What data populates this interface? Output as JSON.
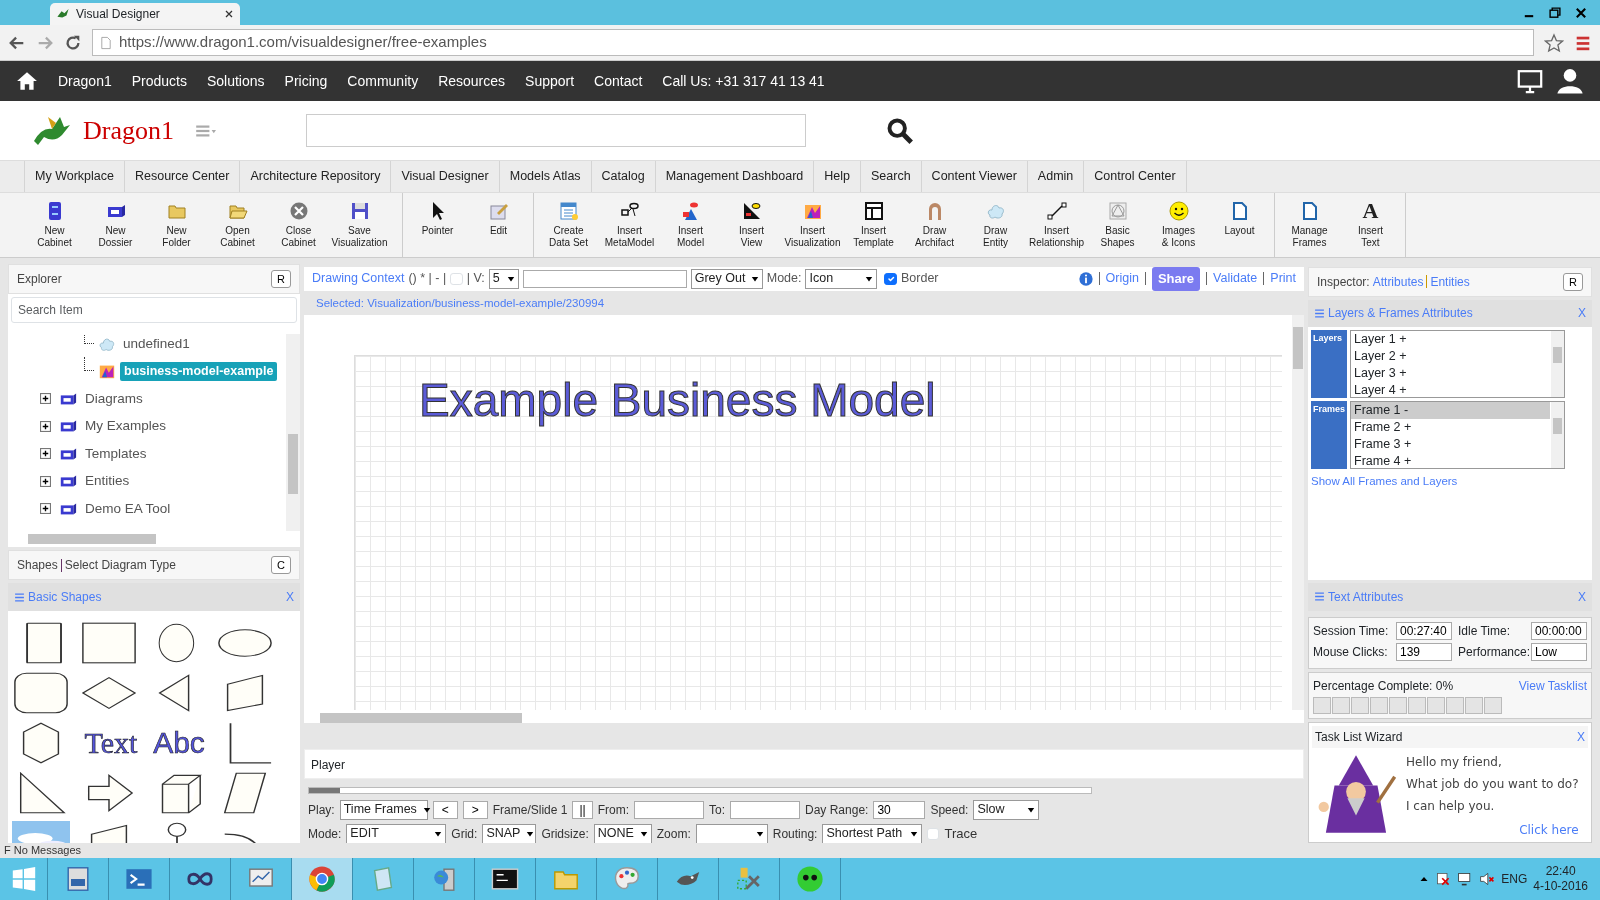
{
  "browser": {
    "tab_title": "Visual Designer",
    "url": "https://www.dragon1.com/visualdesigner/free-examples"
  },
  "site_nav": {
    "items": [
      "Dragon1",
      "Products",
      "Solutions",
      "Pricing",
      "Community",
      "Resources",
      "Support",
      "Contact"
    ],
    "phone": "Call Us: +31 317 41 13 41"
  },
  "logo": {
    "text": "Dragon1"
  },
  "menu_tabs": [
    "My Workplace",
    "Resource Center",
    "Architecture Repository",
    "Visual Designer",
    "Models Atlas",
    "Catalog",
    "Management Dashboard",
    "Help",
    "Search",
    "Content Viewer",
    "Admin",
    "Control Center"
  ],
  "toolbar": {
    "groups": [
      {
        "buttons": [
          {
            "lines": [
              "New",
              "Cabinet"
            ]
          },
          {
            "lines": [
              "New",
              "Dossier"
            ]
          },
          {
            "lines": [
              "New",
              "Folder"
            ]
          },
          {
            "lines": [
              "Open",
              "Cabinet"
            ]
          },
          {
            "lines": [
              "Close",
              "Cabinet"
            ]
          },
          {
            "lines": [
              "Save",
              "Visualization"
            ]
          }
        ]
      },
      {
        "buttons": [
          {
            "lines": [
              "Pointer"
            ]
          },
          {
            "lines": [
              "Edit"
            ]
          }
        ]
      },
      {
        "buttons": [
          {
            "lines": [
              "Create",
              "Data Set"
            ]
          },
          {
            "lines": [
              "Insert",
              "MetaModel"
            ]
          },
          {
            "lines": [
              "Insert",
              "Model"
            ]
          },
          {
            "lines": [
              "Insert",
              "View"
            ]
          },
          {
            "lines": [
              "Insert",
              "Visualization"
            ]
          },
          {
            "lines": [
              "Insert",
              "Template"
            ]
          },
          {
            "lines": [
              "Draw",
              "Archifact"
            ]
          },
          {
            "lines": [
              "Draw",
              "Entity"
            ]
          },
          {
            "lines": [
              "Insert",
              "Relationship"
            ]
          },
          {
            "lines": [
              "Basic",
              "Shapes"
            ]
          },
          {
            "lines": [
              "Images",
              "& Icons"
            ]
          },
          {
            "lines": [
              "Layout"
            ]
          }
        ]
      },
      {
        "buttons": [
          {
            "lines": [
              "Manage",
              "Frames"
            ]
          },
          {
            "lines": [
              "Insert",
              "Text"
            ],
            "glyph": "A"
          }
        ]
      }
    ]
  },
  "explorer": {
    "title": "Explorer",
    "button": "R",
    "search": {
      "placeholder": "Search Item"
    },
    "tree": [
      {
        "label": "undefined1",
        "selected": false
      },
      {
        "label": "business-model-example",
        "selected": true
      }
    ],
    "folders": [
      {
        "label": "Diagrams",
        "expanded": false
      },
      {
        "label": "My Examples",
        "expanded": false
      },
      {
        "label": "Templates",
        "expanded": false
      },
      {
        "label": "Entities",
        "expanded": false
      },
      {
        "label": "Demo EA Tool",
        "expanded": false
      }
    ]
  },
  "shapes": {
    "title": "Shapes",
    "link": "Select Diagram Type",
    "button": "C",
    "panel_title": "Basic Shapes",
    "close": "X",
    "items": [
      {
        "kind": "square"
      },
      {
        "kind": "rectangle"
      },
      {
        "kind": "circle"
      },
      {
        "kind": "ellipse"
      },
      {
        "kind": "rounded"
      },
      {
        "kind": "diamond"
      },
      {
        "kind": "triangle"
      },
      {
        "kind": "slanted"
      },
      {
        "kind": "hexagon"
      },
      {
        "kind": "text",
        "label": "Text"
      },
      {
        "kind": "text",
        "label": "Abc"
      },
      {
        "kind": "corner"
      },
      {
        "kind": "right-triangle"
      },
      {
        "kind": "arrow"
      },
      {
        "kind": "cube"
      },
      {
        "kind": "parallelogram"
      },
      {
        "kind": "picture"
      },
      {
        "kind": "slanted"
      },
      {
        "kind": "actor"
      },
      {
        "kind": "arc"
      }
    ]
  },
  "context_bar": {
    "title": "Drawing Context",
    "marks": "() * | - |",
    "border_box": false,
    "v_label": "| V:",
    "v_value": "5",
    "grey_select": "Grey Out",
    "mode_label": "Mode:",
    "mode_value": "Icon",
    "border_checked": true,
    "border_label": "Border",
    "links": [
      {
        "label": "Origin",
        "kind": "link"
      },
      {
        "label": "Share",
        "kind": "button"
      },
      {
        "label": "Validate",
        "kind": "link"
      },
      {
        "label": "Print",
        "kind": "link"
      }
    ]
  },
  "selected_path": "Selected: Visualization/business-model-example/230994",
  "canvas": {
    "title": "Example Business Model"
  },
  "player": {
    "title": "Player",
    "level": 0.04,
    "play_label": "Play:",
    "play_value": "Time Frames",
    "prev": "<",
    "next": ">",
    "frame": "Frame/Slide 1",
    "pause": "||",
    "from_label": "From:",
    "to_label": "To:",
    "range_label": "Day Range:",
    "range_value": "30",
    "speed_label": "Speed:",
    "speed_value": "Slow",
    "mode_label": "Mode:",
    "mode_value": "EDIT",
    "grid_label": "Grid:",
    "grid_value": "SNAP",
    "gridsize_label": "Gridsize:",
    "gridsize_value": "NONE",
    "zoom_label": "Zoom:",
    "routing_label": "Routing:",
    "routing_value": "Shortest Path",
    "trace_checked": false,
    "trace_label": "Trace"
  },
  "inspector": {
    "label": "Inspector:",
    "tabs": [
      "Attributes",
      "Entities"
    ],
    "button": "R",
    "layers_panel": {
      "title": "Layers & Frames Attributes",
      "close": "X",
      "layers_label": "Layers",
      "frames_label": "Frames",
      "layers": [
        {
          "label": "Layer 1 +",
          "selected": false
        },
        {
          "label": "Layer 2 +",
          "selected": false
        },
        {
          "label": "Layer 3 +",
          "selected": false
        },
        {
          "label": "Layer 4 +",
          "selected": false
        }
      ],
      "frames": [
        {
          "label": "Frame 1 -",
          "selected": true
        },
        {
          "label": "Frame 2 +",
          "selected": false
        },
        {
          "label": "Frame 3 +",
          "selected": false
        },
        {
          "label": "Frame 4 +",
          "selected": false
        }
      ],
      "link": "Show All Frames and Layers"
    },
    "text_panel": {
      "title": "Text Attributes",
      "close": "X"
    }
  },
  "stats": {
    "session_label": "Session Time:",
    "session": "00:27:40",
    "idle_label": "Idle Time:",
    "idle": "00:00:00",
    "clicks_label": "Mouse Clicks:",
    "clicks": "139",
    "perf_label": "Performance:",
    "perf": "Low"
  },
  "progress": {
    "label": "Percentage Complete: 0%",
    "link": "View Tasklist",
    "segments": [
      {
        "done": false
      },
      {
        "done": false
      },
      {
        "done": false
      },
      {
        "done": false
      },
      {
        "done": false
      },
      {
        "done": false
      },
      {
        "done": false
      },
      {
        "done": false
      },
      {
        "done": false
      },
      {
        "done": false
      }
    ]
  },
  "wizard": {
    "title": "Task List Wizard",
    "close": "X",
    "lines": [
      "Hello my friend,",
      "What job do you want to do?",
      "I can help you."
    ],
    "link": "Click here"
  },
  "status_bar": "F No Messages",
  "taskbar": {
    "language": "ENG",
    "time": "22:40",
    "date": "4-10-2016"
  }
}
